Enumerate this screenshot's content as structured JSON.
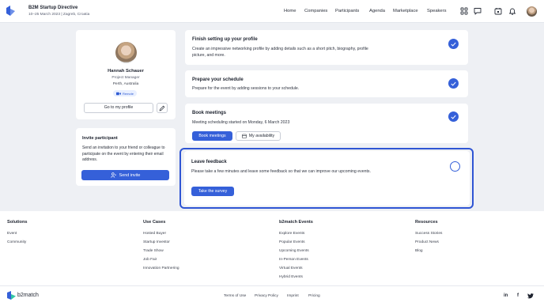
{
  "header": {
    "event_title": "B2M Startup Directive",
    "event_sub": "10–25 March 2023 | Zagreb, Croatia",
    "nav": [
      "Home",
      "Companies",
      "Participants",
      "Agenda",
      "Marketplace",
      "Speakers"
    ]
  },
  "profile": {
    "name": "Hannah Schauer",
    "role": "Project Manager",
    "location": "Perth, Australia",
    "badge": "Remote",
    "goto_label": "Go to my profile"
  },
  "invite": {
    "title": "Invite participant",
    "description": "Send an invitation to your friend or colleague to participate on the event by entering their email address.",
    "button": "Send invite"
  },
  "tasks": {
    "profile": {
      "title": "Finish setting up your profile",
      "desc": "Create an impressive networking profile by adding details such as a short pitch, biography, profile picture, and more."
    },
    "schedule": {
      "title": "Prepare your schedule",
      "desc": "Prepare for the event by adding sessions to your schedule."
    },
    "meetings": {
      "title": "Book meetings",
      "desc": "Meeting scheduling started on Monday, 6 March 2023",
      "book_btn": "Book meetings",
      "avail_btn": "My availability"
    },
    "feedback": {
      "title": "Leave feedback",
      "desc": "Please take a few minutes and leave some feedback so that we can improve our upcoming events.",
      "survey_btn": "Take the survey"
    }
  },
  "footer": {
    "columns": [
      {
        "title": "Solutions",
        "links": [
          "Event",
          "Community"
        ]
      },
      {
        "title": "Use Cases",
        "links": [
          "Hosted Buyer",
          "Startup Investor",
          "Trade Show",
          "Job Fair",
          "Innovation Partnering"
        ]
      },
      {
        "title": "b2match Events",
        "links": [
          "Explore Events",
          "Popular Events",
          "Upcoming Events",
          "In-Person Events",
          "Virtual Events",
          "Hybrid Events"
        ]
      },
      {
        "title": "Resources",
        "links": [
          "Success Stories",
          "Product News",
          "Blog"
        ]
      }
    ],
    "brand": "b2match",
    "bottom_links": [
      "Terms of Use",
      "Privacy Policy",
      "Imprint",
      "Pricing"
    ],
    "social": [
      "in",
      "f",
      "twitter"
    ]
  },
  "colors": {
    "accent": "#3560d9",
    "background": "#eef0f4"
  }
}
